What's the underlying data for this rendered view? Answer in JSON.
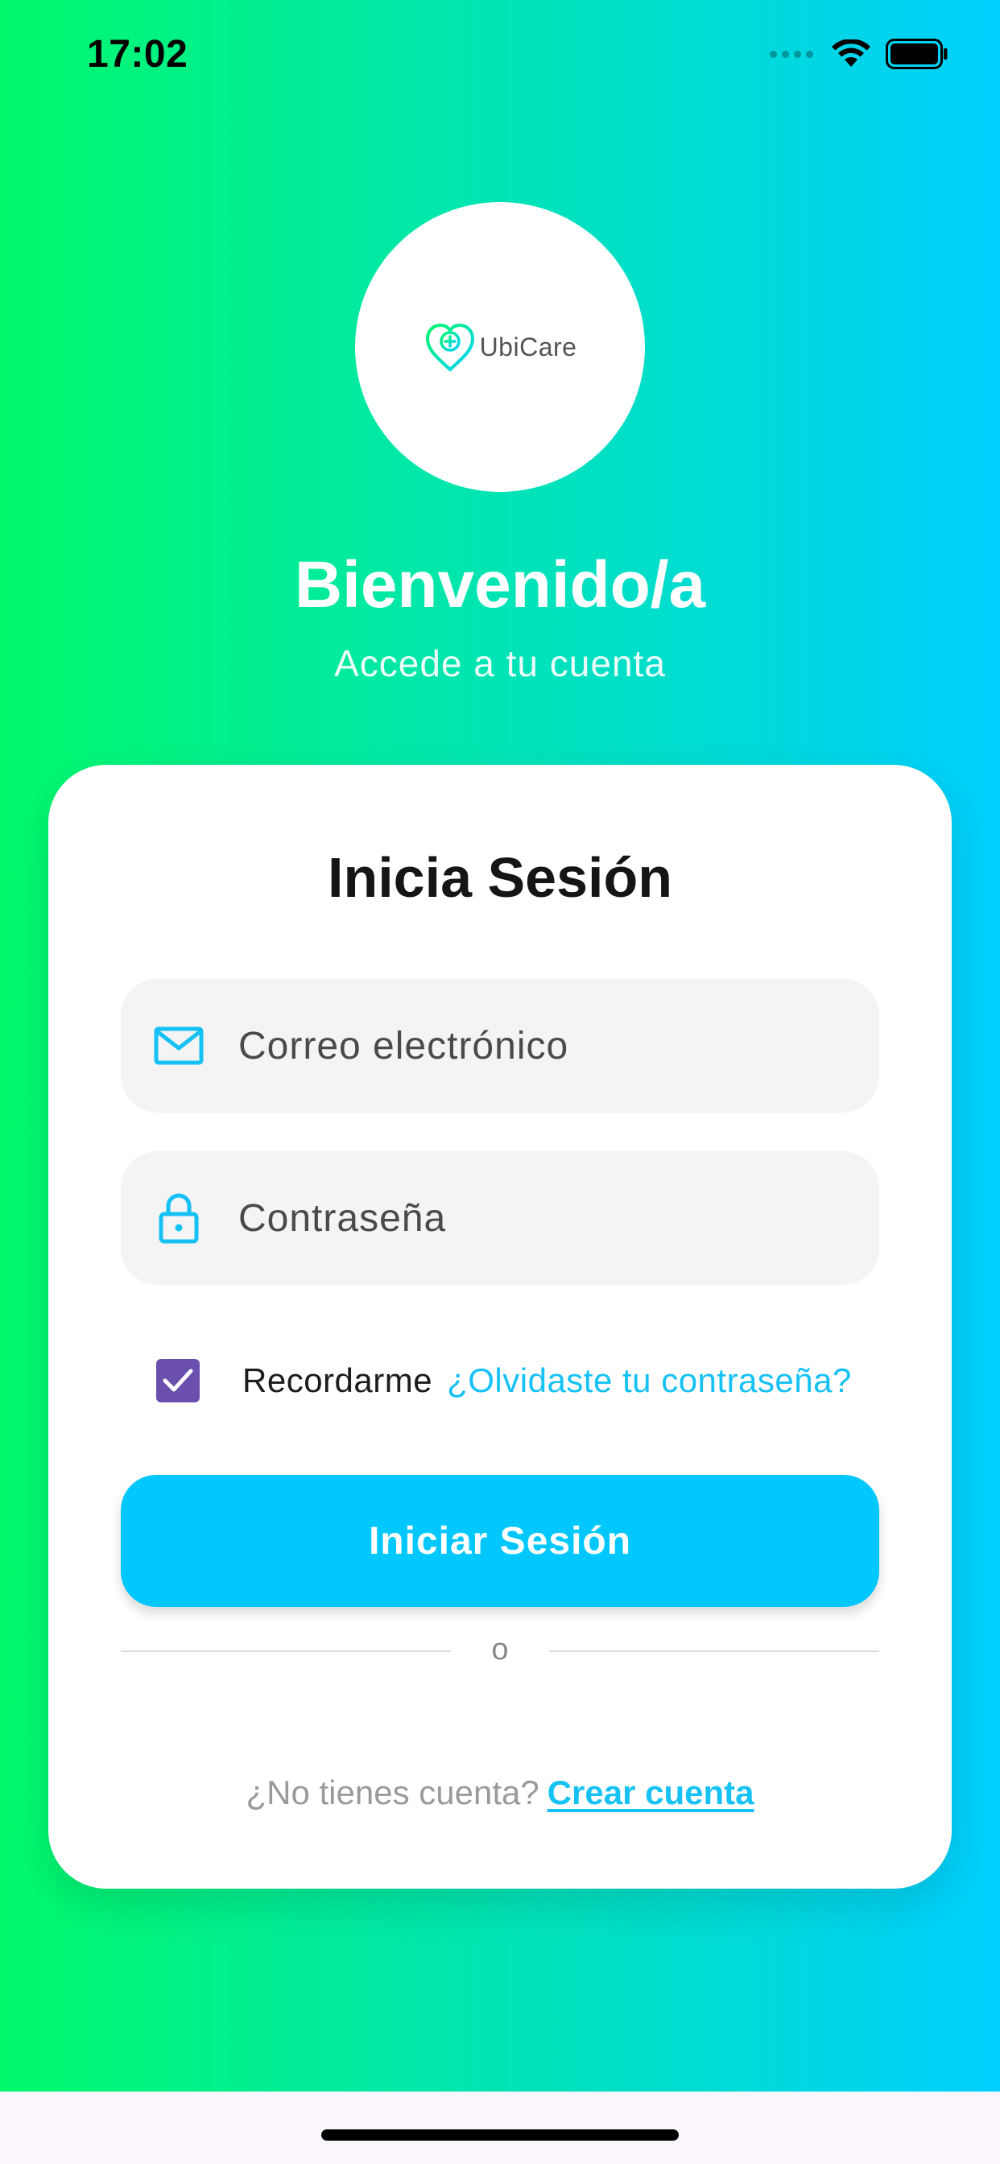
{
  "status_bar": {
    "time": "17:02",
    "icons": [
      "signal-icon",
      "wifi-icon",
      "battery-icon"
    ]
  },
  "logo": {
    "brand": "UbiCare",
    "icon": "heart-location-icon"
  },
  "header": {
    "title": "Bienvenido/a",
    "subtitle": "Accede a tu cuenta"
  },
  "form": {
    "title": "Inicia Sesión",
    "email": {
      "placeholder": "Correo electrónico",
      "value": "",
      "icon": "mail-icon"
    },
    "password": {
      "placeholder": "Contraseña",
      "value": "",
      "icon": "lock-icon"
    },
    "remember": {
      "label": "Recordarme",
      "checked": true
    },
    "forgot_label": "¿Olvidaste tu contraseña?",
    "submit_label": "Iniciar Sesión",
    "divider_label": "o",
    "signup_prompt": "¿No tienes cuenta?",
    "signup_link": "Crear cuenta"
  },
  "colors": {
    "gradient_start": "#00f96a",
    "gradient_end": "#00cfff",
    "accent": "#00c8ff",
    "link": "#16c1f5",
    "checkbox": "#6a4fae"
  }
}
